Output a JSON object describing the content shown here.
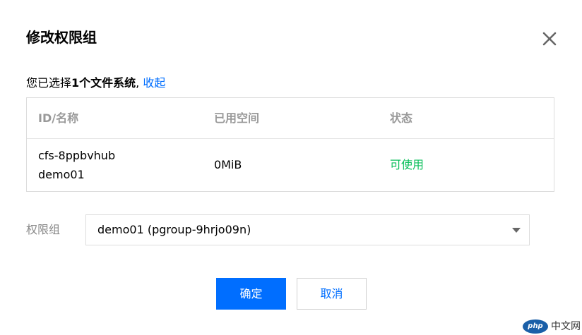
{
  "dialog": {
    "title": "修改权限组"
  },
  "selection": {
    "prefix": "您已选择",
    "count_text": "1个文件系统",
    "separator": ", ",
    "collapse_label": "收起"
  },
  "table": {
    "headers": [
      "ID/名称",
      "已用空间",
      "状态"
    ],
    "rows": [
      {
        "id": "cfs-8ppbvhub",
        "name": "demo01",
        "used_space": "0MiB",
        "status": "可使用"
      }
    ]
  },
  "permission_group": {
    "label": "权限组",
    "selected_value": "demo01 (pgroup-9hrjo09n)"
  },
  "buttons": {
    "confirm": "确定",
    "cancel": "取消"
  },
  "watermark": {
    "logo_text": "php",
    "site_text": "中文网"
  },
  "icons": {
    "close": "close-icon",
    "dropdown": "chevron-down-icon"
  },
  "colors": {
    "primary": "#006eff",
    "status_ok": "#0abf5b",
    "border": "#dcdcdc",
    "header_text": "#999999",
    "label_text": "#888888"
  }
}
